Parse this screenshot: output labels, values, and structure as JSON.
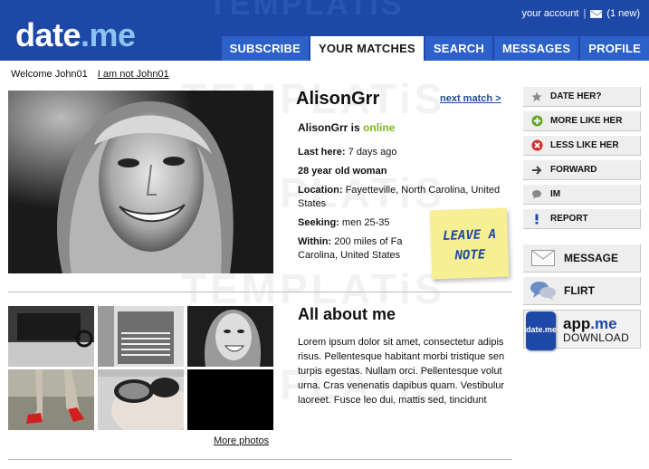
{
  "header": {
    "logo_word": "date",
    "logo_domain": ".me",
    "account_link": "your account",
    "separator": "|",
    "messages_count": "(1 new)",
    "tabs": [
      {
        "label": "SUBSCRIBE"
      },
      {
        "label": "YOUR MATCHES"
      },
      {
        "label": "SEARCH"
      },
      {
        "label": "MESSAGES"
      },
      {
        "label": "PROFILE"
      }
    ],
    "watermark": "TEMPLATiS"
  },
  "welcome": {
    "greeting": "Welcome John01",
    "not_me_link": "I am not John01"
  },
  "profile": {
    "name": "AlisonGrr",
    "next_match": "next match >",
    "status_prefix": "AlisonGrr is",
    "status": "online",
    "last_here_label": "Last here:",
    "last_here_value": "7 days ago",
    "age_gender": "28 year old woman",
    "location_label": "Location:",
    "location_value": "Fayetteville, North Carolina, United States",
    "seeking_label": "Seeking:",
    "seeking_value": "men 25-35",
    "within_label": "Within:",
    "within_value": "200 miles of Fa Carolina, United States",
    "note_text": "LEAVE A NOTE"
  },
  "about": {
    "title": "All about me",
    "body": "Lorem ipsum dolor sit amet, consectetur adipis risus. Pellentesque habitant morbi tristique sen turpis egestas. Nullam orci. Pellentesque volut urna. Cras venenatis dapibus quam. Vestibulur laoreet. Fusce leo dui, mattis sed, tincidunt",
    "more_photos": "More photos"
  },
  "actions": [
    {
      "label": "DATE HER?",
      "icon": "star-icon"
    },
    {
      "label": "MORE LIKE HER",
      "icon": "plus-circle-icon"
    },
    {
      "label": "LESS LIKE HER",
      "icon": "minus-circle-icon"
    },
    {
      "label": "FORWARD",
      "icon": "arrow-right-icon"
    },
    {
      "label": "IM",
      "icon": "chat-bubble-icon"
    },
    {
      "label": "REPORT",
      "icon": "exclamation-icon"
    }
  ],
  "big_actions": [
    {
      "label": "MESSAGE",
      "icon": "envelope-icon"
    },
    {
      "label": "FLIRT",
      "icon": "chat-bubbles-icon"
    }
  ],
  "app": {
    "logo_text": "date.me",
    "title_word": "app",
    "title_domain": ".me",
    "download": "DOWNLOAD"
  },
  "colors": {
    "header_blue": "#1d48a8",
    "tab_blue": "#2c61c9",
    "online_green": "#7cb61d",
    "note_yellow": "#f6ef93",
    "link_blue": "#1d48a8"
  }
}
